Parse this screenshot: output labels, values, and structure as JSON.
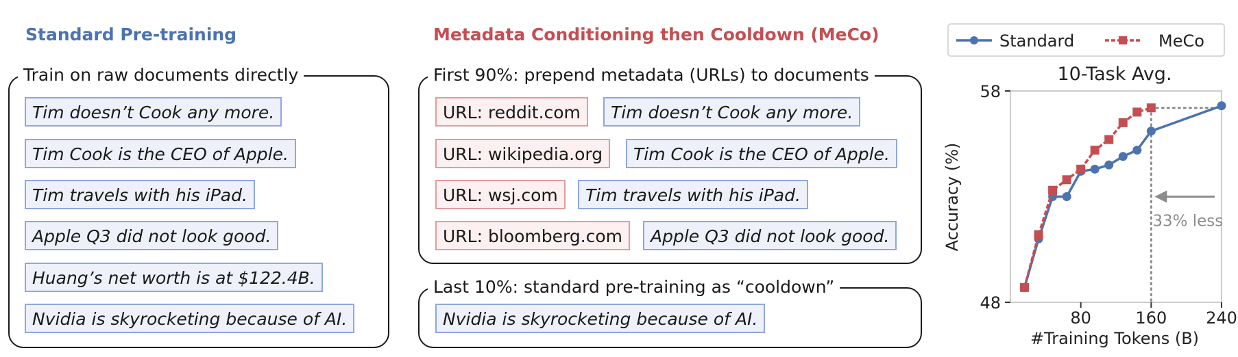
{
  "standard": {
    "heading": "Standard Pre-training",
    "group_label": "Train on raw documents directly",
    "docs": [
      "Tim doesn’t Cook any more.",
      "Tim Cook is the CEO of Apple.",
      "Tim travels with his iPad.",
      "Apple Q3 did not look good.",
      "Huang’s net worth is at $122.4B.",
      "Nvidia is skyrocketing because of AI."
    ]
  },
  "meco": {
    "heading": "Metadata Conditioning then Cooldown (MeCo)",
    "first_label": "First 90%: prepend metadata (URLs) to documents",
    "metadata_pairs": [
      {
        "url": "URL: reddit.com",
        "doc": "Tim doesn’t Cook any more."
      },
      {
        "url": "URL: wikipedia.org",
        "doc": "Tim Cook is the CEO of Apple."
      },
      {
        "url": "URL: wsj.com",
        "doc": "Tim travels with his iPad."
      },
      {
        "url": "URL: bloomberg.com",
        "doc": "Apple Q3 did not look good."
      }
    ],
    "last_label": "Last 10%: standard pre-training as “cooldown”",
    "cooldown_doc": "Nvidia is skyrocketing because of AI."
  },
  "colors": {
    "standard": "#4c72b0",
    "meco": "#c44e52",
    "annotation": "#8c8c8c"
  },
  "chart_data": {
    "type": "line",
    "title": "10-Task Avg.",
    "xlabel": "#Training Tokens (B)",
    "ylabel": "Accuracy (%)",
    "xlim": [
      0,
      240
    ],
    "ylim": [
      48,
      58
    ],
    "xticks": [
      80,
      160,
      240
    ],
    "yticks": [
      48,
      58
    ],
    "grid": false,
    "legend_position": "top",
    "series": [
      {
        "name": "Standard",
        "color": "#4c72b0",
        "marker": "circle",
        "x": [
          16,
          32,
          48,
          64,
          80,
          96,
          112,
          128,
          144,
          160,
          240
        ],
        "y": [
          48.7,
          51.0,
          53.0,
          53.0,
          54.2,
          54.3,
          54.5,
          54.9,
          55.2,
          56.1,
          57.3
        ]
      },
      {
        "name": "MeCo",
        "color": "#c44e52",
        "marker": "square",
        "x": [
          16,
          32,
          48,
          64,
          80,
          96,
          112,
          128,
          144,
          160
        ],
        "y": [
          48.7,
          51.2,
          53.3,
          53.8,
          54.3,
          55.2,
          55.7,
          56.5,
          57.0,
          57.2
        ]
      }
    ],
    "annotation": {
      "text": "33% less",
      "match_y": 57.2,
      "meco_x": 160,
      "standard_x": 240
    }
  }
}
